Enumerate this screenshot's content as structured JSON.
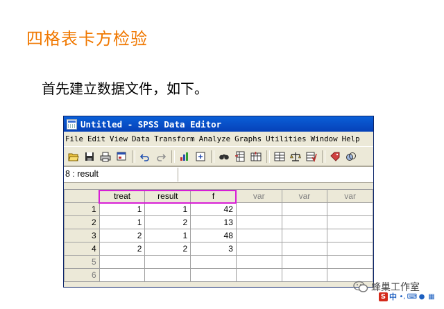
{
  "slide": {
    "title": "四格表卡方检验",
    "text": "首先建立数据文件，如下。"
  },
  "window": {
    "title": "Untitled - SPSS Data Editor"
  },
  "menu": [
    "File",
    "Edit",
    "View",
    "Data",
    "Transform",
    "Analyze",
    "Graphs",
    "Utilities",
    "Window",
    "Help"
  ],
  "toolbar_icons": [
    "open-icon",
    "save-icon",
    "print-icon",
    "dialog-recall-icon",
    "undo-icon",
    "redo-icon",
    "goto-chart-icon",
    "goto-case-icon",
    "find-icon",
    "insert-case-icon",
    "insert-variable-icon",
    "split-file-icon",
    "weight-cases-icon",
    "select-cases-icon",
    "value-labels-icon",
    "use-sets-icon"
  ],
  "cell_reference": "8 : result",
  "grid": {
    "columns": [
      "treat",
      "result",
      "f",
      "var",
      "var",
      "var"
    ],
    "rows": [
      {
        "num": "1",
        "cells": [
          "1",
          "1",
          "42",
          "",
          "",
          ""
        ]
      },
      {
        "num": "2",
        "cells": [
          "1",
          "2",
          "13",
          "",
          "",
          ""
        ]
      },
      {
        "num": "3",
        "cells": [
          "2",
          "1",
          "48",
          "",
          "",
          ""
        ]
      },
      {
        "num": "4",
        "cells": [
          "2",
          "2",
          "3",
          "",
          "",
          ""
        ]
      },
      {
        "num": "5",
        "cells": [
          "",
          "",
          "",
          "",
          "",
          ""
        ]
      },
      {
        "num": "6",
        "cells": [
          "",
          "",
          "",
          "",
          "",
          ""
        ]
      }
    ]
  },
  "watermark": {
    "label": "蜂巢工作室"
  },
  "ime": {
    "logo": "S",
    "lang": "中",
    "punct": "•,"
  },
  "colors": {
    "title": "#f07800",
    "highlight": "#d81ed6",
    "titlebar": "#0641b8"
  }
}
